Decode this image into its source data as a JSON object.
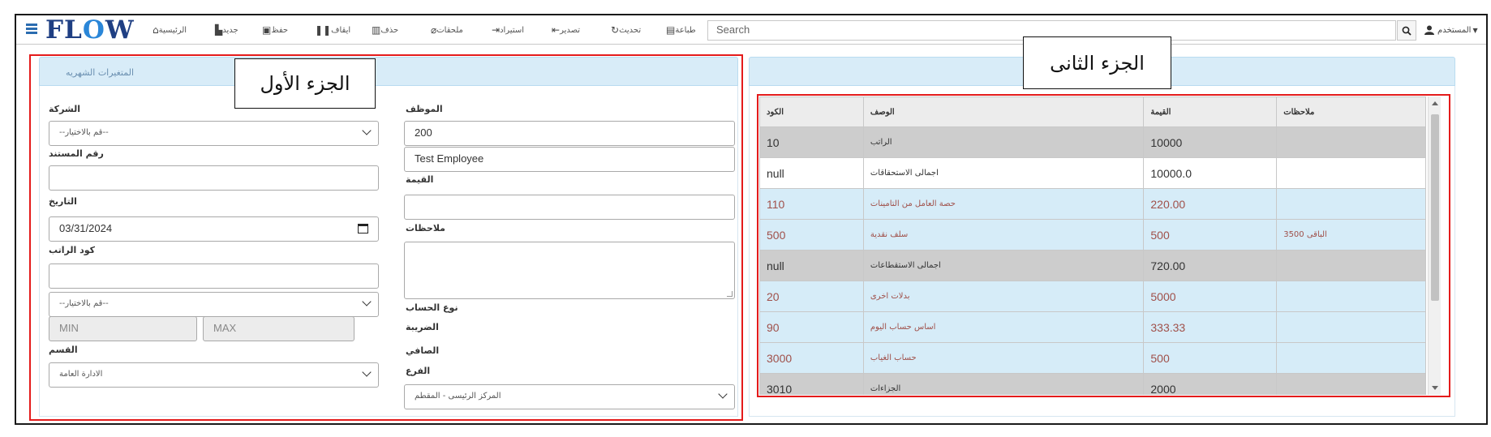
{
  "app": {
    "logo_pre": "FL",
    "logo_o": "O",
    "logo_post": "W"
  },
  "toolbar": {
    "home": "الرئيسية",
    "new": "جديد",
    "save": "حفظ",
    "stop": "ايقاف",
    "delete": "حذف",
    "attachments": "ملحقات",
    "import": "استيراد",
    "export": "تصدير",
    "refresh": "تحديث",
    "print": "طباعة",
    "search_placeholder": "Search",
    "user": "المستخدم"
  },
  "callouts": {
    "part1": "الجزء الأول",
    "part2": "الجزء الثانى"
  },
  "left_panel": {
    "title": "المتغيرات الشهريه",
    "labels": {
      "company": "الشركة",
      "employee": "الموظف",
      "doc_no": "رقم المستند",
      "value": "القيمة",
      "date": "التاريخ",
      "notes": "ملاحظات",
      "salary_code": "كود الراتب",
      "account_type": "نوع الحساب",
      "tax": "الضريبة",
      "net": "الصافي",
      "department": "القسم",
      "branch": "الفرع"
    },
    "values": {
      "company_select": "--قم بالاختيار--",
      "employee_code": "200",
      "employee_name": "Test Employee",
      "date": "03/31/2024",
      "salary_select": "--قم بالاختيار--",
      "min_placeholder": "MIN",
      "max_placeholder": "MAX",
      "department_select": "الادارة العامة",
      "branch_select": "المركز الرئيسى - المقطم"
    }
  },
  "table": {
    "headers": [
      "الكود",
      "الوصف",
      "القيمة",
      "ملاحظات"
    ],
    "rows": [
      {
        "style": "gray",
        "code": "10",
        "desc": "الراتب",
        "value": "10000",
        "notes": ""
      },
      {
        "style": "white",
        "code": "null",
        "desc": "اجمالى الاستحقاقات",
        "value": "10000.0",
        "notes": ""
      },
      {
        "style": "blue",
        "code": "110",
        "desc": "حصة العامل من التامينات",
        "value": "220.00",
        "notes": ""
      },
      {
        "style": "blue",
        "code": "500",
        "desc": "سلف نقدية",
        "value": "500",
        "notes": "الباقى 3500"
      },
      {
        "style": "gray",
        "code": "null",
        "desc": "اجمالى الاستقطاعات",
        "value": "720.00",
        "notes": ""
      },
      {
        "style": "blue",
        "code": "20",
        "desc": "بدلات اخرى",
        "value": "5000",
        "notes": ""
      },
      {
        "style": "blue",
        "code": "90",
        "desc": "اساس حساب اليوم",
        "value": "333.33",
        "notes": ""
      },
      {
        "style": "blue",
        "code": "3000",
        "desc": "حساب الغياب",
        "value": "500",
        "notes": ""
      },
      {
        "style": "gray",
        "code": "3010",
        "desc": "الجزاءات",
        "value": "2000",
        "notes": ""
      }
    ]
  },
  "colors": {
    "accent": "#1f3f83",
    "red_box": "#e41b1b",
    "panel_head": "#d8ecf8"
  }
}
